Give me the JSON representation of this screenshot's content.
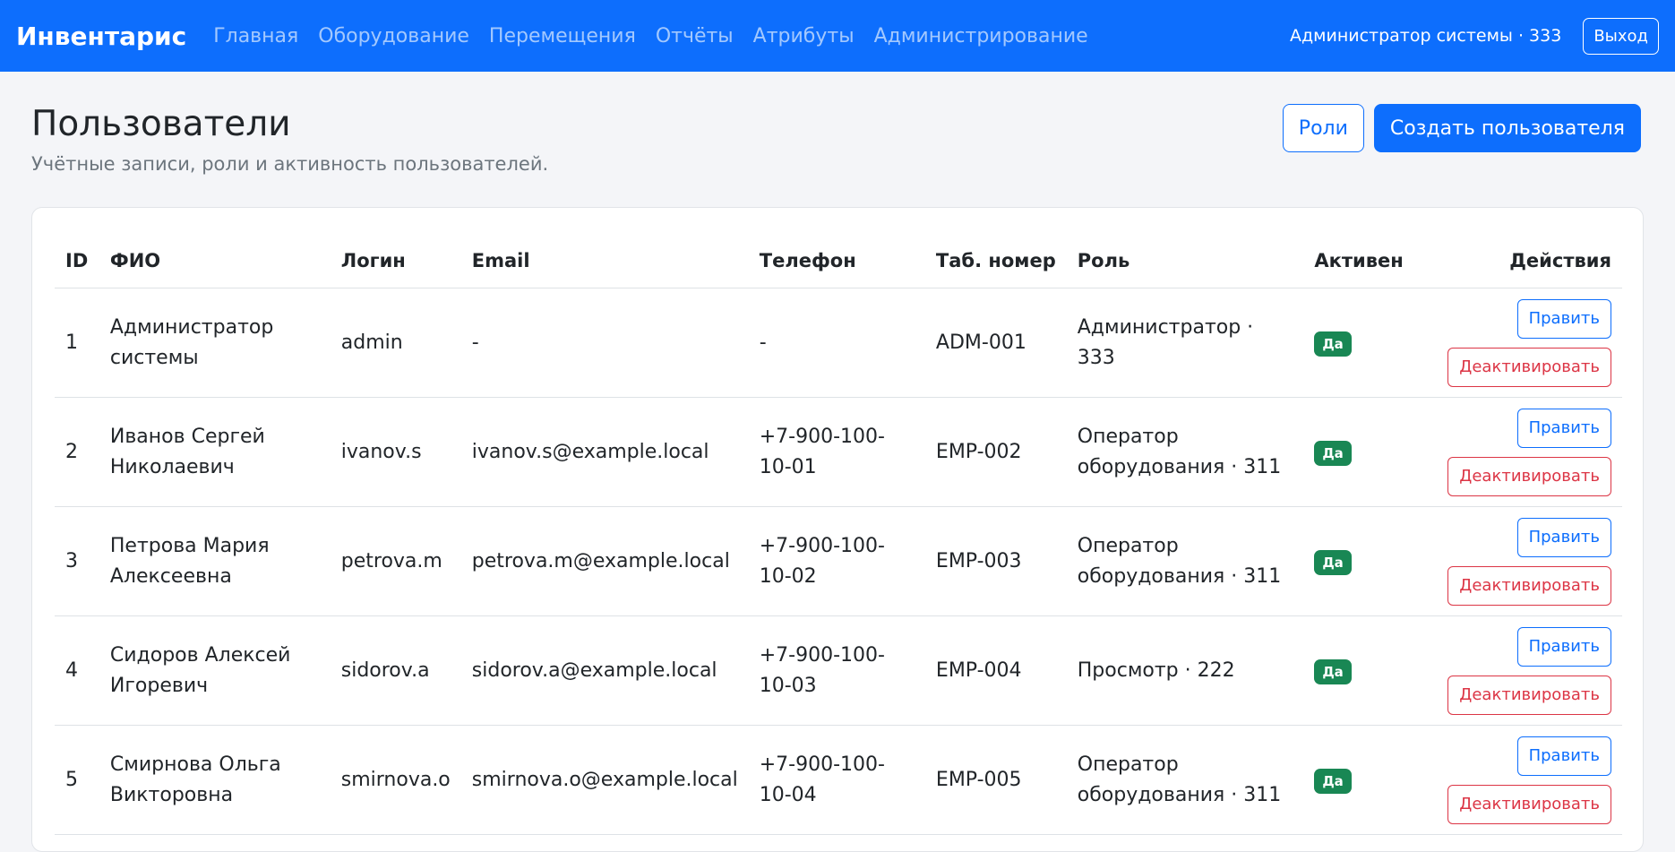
{
  "nav": {
    "brand": "Инвентарис",
    "links": [
      "Главная",
      "Оборудование",
      "Перемещения",
      "Отчёты",
      "Атрибуты",
      "Администрирование"
    ],
    "user": "Администратор системы · 333",
    "logout": "Выход"
  },
  "page": {
    "title": "Пользователи",
    "subtitle": "Учётные записи, роли и активность пользователей.",
    "roles_button": "Роли",
    "create_button": "Создать пользователя"
  },
  "table": {
    "headers": [
      "ID",
      "ФИО",
      "Логин",
      "Email",
      "Телефон",
      "Таб. номер",
      "Роль",
      "Активен",
      "Действия"
    ],
    "rows": [
      {
        "id": "1",
        "fio": "Администратор системы",
        "login": "admin",
        "email": "-",
        "phone": "-",
        "tab": "ADM-001",
        "role": "Администратор · 333",
        "active": "Да"
      },
      {
        "id": "2",
        "fio": "Иванов Сергей Николаевич",
        "login": "ivanov.s",
        "email": "ivanov.s@example.local",
        "phone": "+7-900-100-10-01",
        "tab": "EMP-002",
        "role": "Оператор оборудования · 311",
        "active": "Да"
      },
      {
        "id": "3",
        "fio": "Петрова Мария Алексеевна",
        "login": "petrova.m",
        "email": "petrova.m@example.local",
        "phone": "+7-900-100-10-02",
        "tab": "EMP-003",
        "role": "Оператор оборудования · 311",
        "active": "Да"
      },
      {
        "id": "4",
        "fio": "Сидоров Алексей Игоревич",
        "login": "sidorov.a",
        "email": "sidorov.a@example.local",
        "phone": "+7-900-100-10-03",
        "tab": "EMP-004",
        "role": "Просмотр · 222",
        "active": "Да"
      },
      {
        "id": "5",
        "fio": "Смирнова Ольга Викторовна",
        "login": "smirnova.o",
        "email": "smirnova.o@example.local",
        "phone": "+7-900-100-10-04",
        "tab": "EMP-005",
        "role": "Оператор оборудования · 311",
        "active": "Да"
      }
    ],
    "edit_label": "Править",
    "deactivate_label": "Деактивировать"
  },
  "colors": {
    "primary": "#0d6efd",
    "danger": "#dc3545",
    "success": "#198754"
  }
}
